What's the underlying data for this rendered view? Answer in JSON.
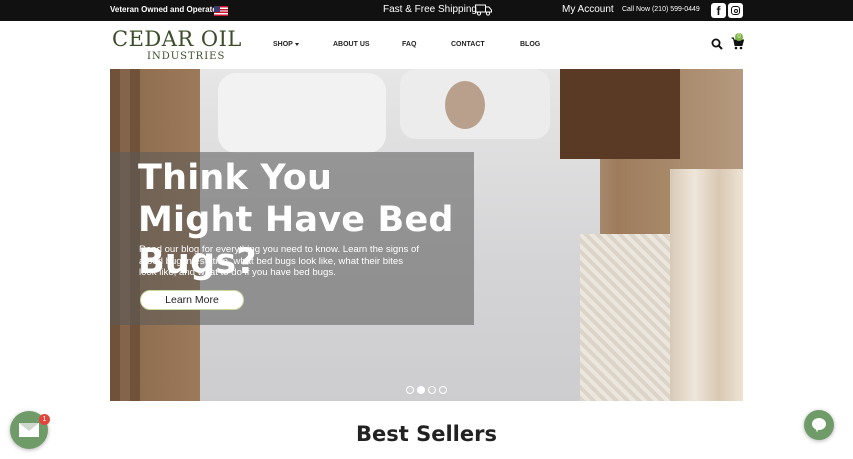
{
  "topbar": {
    "veteran_text": "Veteran Owned and Operated",
    "flag_icon": "us-flag-icon",
    "shipping_text": "Fast & Free Shipping",
    "truck_icon": "truck-icon",
    "account_label": "My Account",
    "call_text": "Call Now (210) 599-0449",
    "facebook_icon": "facebook-icon",
    "facebook_glyph": "f",
    "instagram_icon": "instagram-icon"
  },
  "nav": {
    "logo_line1": "CEDAR OIL",
    "logo_line2": "INDUSTRIES",
    "items": [
      {
        "label": "SHOP",
        "has_caret": true
      },
      {
        "label": "ABOUT US"
      },
      {
        "label": "FAQ"
      },
      {
        "label": "CONTACT"
      },
      {
        "label": "BLOG"
      }
    ],
    "search_icon": "search-icon",
    "cart_icon": "cart-icon",
    "cart_count": "0"
  },
  "hero": {
    "title": "Think You Might Have Bed Bugs?",
    "subtitle": "Read our blog for everything you need to know. Learn the signs of a bed bug infestation, what bed bugs look like, what their bites look like, and what to do if you have bed bugs.",
    "cta_label": "Learn More",
    "slide_count": 4,
    "active_slide": 2
  },
  "section": {
    "heading": "Best Sellers"
  },
  "floating": {
    "mail_icon": "envelope-icon",
    "mail_badge": "1",
    "chat_icon": "chat-bubble-icon"
  },
  "colors": {
    "topbar_bg": "#111111",
    "logo_green": "#3b4d2a",
    "accent_green": "#6f9b69",
    "badge_red": "#e2453c",
    "cart_badge": "#7fb540"
  }
}
